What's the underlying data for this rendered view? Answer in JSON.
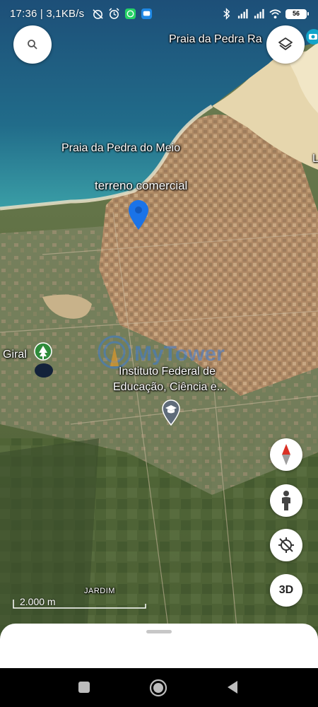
{
  "status_bar": {
    "time": "17:36",
    "speed": "| 3,1KB/s",
    "battery": "56"
  },
  "map": {
    "labels": {
      "beach_top": "Praia da Pedra Ra",
      "beach_meio": "Praia da Pedra do Meio",
      "pin_label": "terreno comercial",
      "giral": "Giral",
      "institute_line1": "Instituto Federal de",
      "institute_line2": "Educação, Ciência e...",
      "jardim": "JARDIM",
      "edge_letter": "L"
    },
    "watermark": "MyTower",
    "scale_text": "2.000 m",
    "colors": {
      "ocean": "#1f5f7d",
      "pin": "#1a73e8",
      "compass_north": "#d93025"
    }
  },
  "controls": {
    "three_d_label": "3D"
  }
}
